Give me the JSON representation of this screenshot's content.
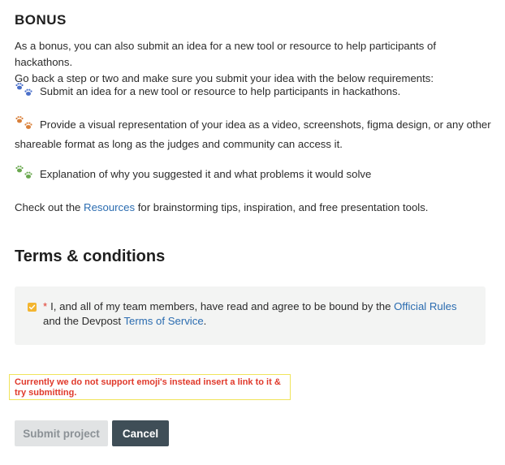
{
  "bonus": {
    "heading": "BONUS",
    "intro_line1": "As a bonus, you can also submit an idea for a new tool or resource to help participants of hackathons.",
    "intro_line2": "Go back a step or two and make sure you submit your idea with the below requirements:",
    "requirements": [
      {
        "icon": "blue-paw-prints-icon",
        "color": "#4a6fc9",
        "text": "Submit an idea for a new tool or resource to help participants in hackathons."
      },
      {
        "icon": "orange-paw-prints-icon",
        "color": "#d9803a",
        "text": "Provide a visual representation of your idea as a video, screenshots, figma design, or any other shareable format as long as the judges and community can access it."
      },
      {
        "icon": "green-paw-prints-icon",
        "color": "#6aa84f",
        "text": "Explanation of why you suggested it and what problems it would solve"
      }
    ],
    "resources_prefix": "Check out the ",
    "resources_link": "Resources",
    "resources_suffix": " for brainstorming tips, inspiration, and free presentation tools."
  },
  "terms": {
    "heading": "Terms & conditions",
    "checked": true,
    "required_mark": "*",
    "text_part1": "I, and all of my team members, have read and agree to be bound by the ",
    "official_rules_link": "Official Rules",
    "text_part2": " and the Devpost ",
    "terms_of_service_link": "Terms of Service",
    "text_part3": "."
  },
  "error": {
    "line1": "Currently we do not support emoji's instead insert a link to it &",
    "line2": "try submitting."
  },
  "buttons": {
    "submit_label": "Submit project",
    "cancel_label": "Cancel"
  },
  "colors": {
    "link": "#2b6cb0",
    "error": "#e0392b",
    "error_border": "#f0e45b",
    "checkbox": "#f3b530",
    "cancel_bg": "#3f4e57",
    "submit_bg": "#e1e3e4"
  }
}
